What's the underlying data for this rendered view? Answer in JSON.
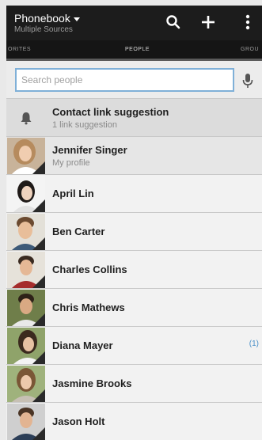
{
  "header": {
    "title": "Phonebook",
    "subtitle": "Multiple Sources"
  },
  "tabs": [
    {
      "label": "ORITES"
    },
    {
      "label": "PEOPLE"
    },
    {
      "label": "GROU"
    }
  ],
  "search": {
    "placeholder": "Search people"
  },
  "suggestion": {
    "title": "Contact link suggestion",
    "subtitle": "1 link suggestion"
  },
  "contacts": [
    {
      "name": "Jennifer Singer",
      "subtitle": "My profile"
    },
    {
      "name": "April Lin"
    },
    {
      "name": "Ben Carter"
    },
    {
      "name": "Charles Collins"
    },
    {
      "name": "Chris Mathews"
    },
    {
      "name": "Diana Mayer",
      "badge": "(1)"
    },
    {
      "name": "Jasmine Brooks"
    },
    {
      "name": "Jason Holt"
    }
  ],
  "icons": {
    "dropdown": "chevron-down-icon",
    "search": "search-icon",
    "add": "plus-icon",
    "overflow": "more-vert-icon",
    "voice": "microphone-icon",
    "notification": "bell-icon"
  },
  "colors": {
    "header_bg": "#1c1c1c",
    "search_border": "#7fb0d8",
    "badge": "#4a90c8"
  }
}
